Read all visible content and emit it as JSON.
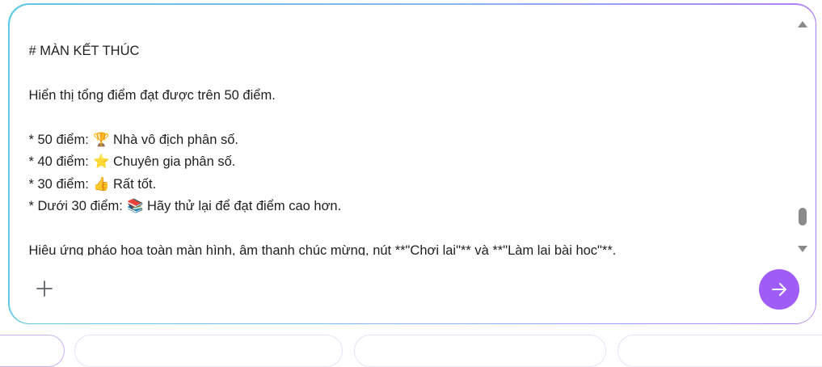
{
  "composer": {
    "heading": "# MÀN KẾT THÚC",
    "intro": "Hiển thị tổng điểm đạt được trên 50 điểm.",
    "tiers": [
      {
        "prefix": "* 50 điểm:",
        "emoji": "🏆",
        "text": "Nhà vô địch phân số."
      },
      {
        "prefix": "* 40 điểm:",
        "emoji": "⭐",
        "text": "Chuyên gia phân số."
      },
      {
        "prefix": "* 30 điểm:",
        "emoji": "👍",
        "text": "Rất tốt."
      },
      {
        "prefix": "* Dưới 30 điểm:",
        "emoji": "📚",
        "text": "Hãy thử lại để đạt điểm cao hơn."
      }
    ],
    "effects": "Hiệu ứng pháo hoa toàn màn hình, âm thanh chúc mừng, nút **\"Chơi lại\"** và **\"Làm lại bài học\"**.",
    "add_icon": "plus-icon",
    "send_icon": "arrow-right-icon"
  },
  "colors": {
    "accent": "#9f5cf6",
    "border_start": "#5ec8e6",
    "border_end": "#b07ef7",
    "text": "#1f1f1f"
  }
}
